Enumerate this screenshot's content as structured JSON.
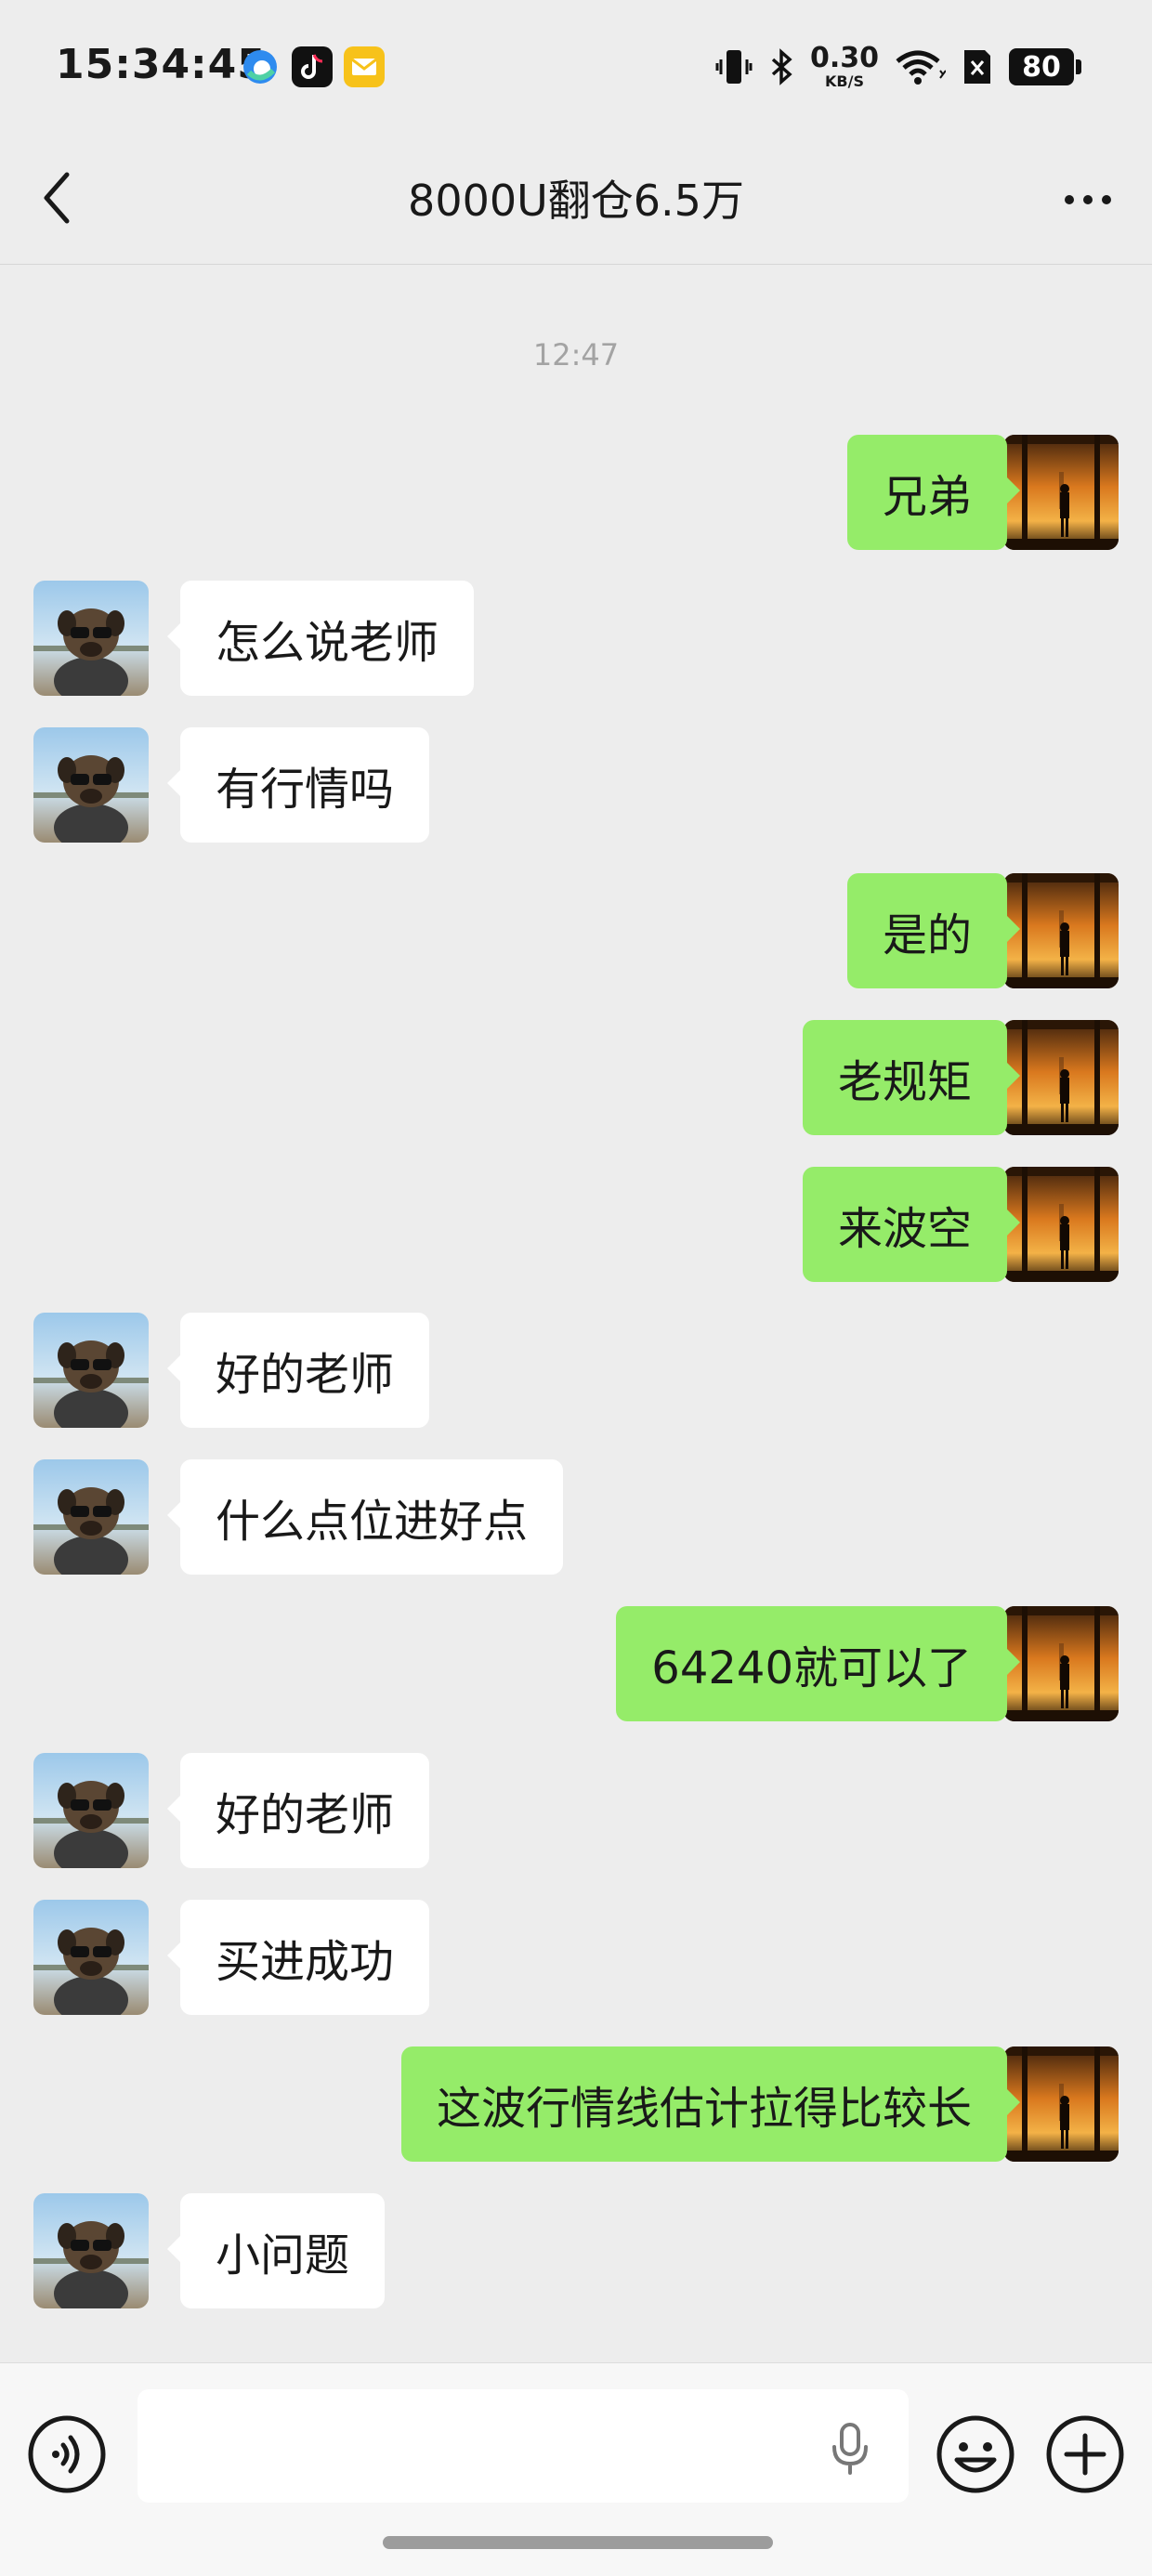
{
  "status_bar": {
    "time": "15:34:45",
    "network_speed": "0.30",
    "network_speed_unit": "KB/S",
    "battery": "80",
    "app_icons": [
      "edge-browser-icon",
      "tiktok-icon",
      "mail-icon"
    ],
    "system_icons": [
      "vibrate-icon",
      "bluetooth-icon",
      "wifi-icon",
      "sim-icon"
    ]
  },
  "header": {
    "title": "8000U翻仓6.5万",
    "back_icon": "chevron-left-icon",
    "more_icon": "more-icon"
  },
  "chat": {
    "timestamp": "12:47",
    "messages": [
      {
        "side": "out",
        "text": "兄弟"
      },
      {
        "side": "in",
        "text": "怎么说老师"
      },
      {
        "side": "in",
        "text": "有行情吗"
      },
      {
        "side": "out",
        "text": "是的"
      },
      {
        "side": "out",
        "text": "老规矩"
      },
      {
        "side": "out",
        "text": "来波空"
      },
      {
        "side": "in",
        "text": "好的老师"
      },
      {
        "side": "in",
        "text": "什么点位进好点"
      },
      {
        "side": "out",
        "text": "64240就可以了"
      },
      {
        "side": "in",
        "text": "好的老师"
      },
      {
        "side": "in",
        "text": "买进成功"
      },
      {
        "side": "out",
        "text": "这波行情线估计拉得比较长"
      },
      {
        "side": "in",
        "text": "小问题"
      }
    ]
  },
  "input_bar": {
    "voice_icon": "voice-toggle-icon",
    "placeholder": "",
    "mic_icon": "microphone-icon",
    "emoji_icon": "emoji-icon",
    "plus_icon": "plus-icon"
  },
  "colors": {
    "background": "#ededed",
    "outgoing_bubble": "#95ec69",
    "incoming_bubble": "#ffffff",
    "timestamp": "#a3a3a3"
  }
}
